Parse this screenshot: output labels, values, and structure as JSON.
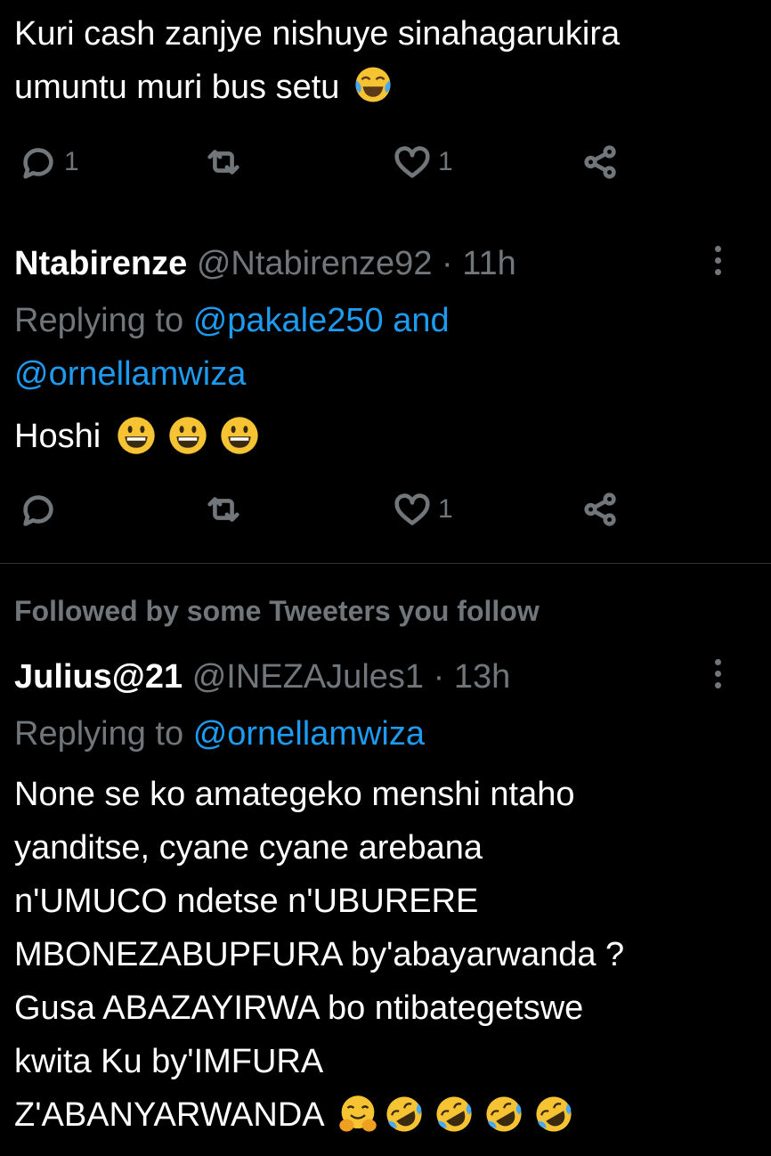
{
  "tweet1": {
    "text_line1": "Kuri cash zanjye nishuye sinahagarukira",
    "text_line2": "umuntu muri bus setu",
    "emoji": "face-with-tears-of-joy",
    "actions": {
      "reply_count": "1",
      "retweet_count": "",
      "like_count": "1"
    }
  },
  "tweet2": {
    "name": "Ntabirenze",
    "handle": "@Ntabirenze92",
    "separator": "·",
    "time": "11h",
    "replying_prefix": "Replying to",
    "replying_user1": "@pakale250",
    "replying_and": "and",
    "replying_user2": "@ornellamwiza",
    "text": "Hoshi",
    "emojis": [
      "grinning-face",
      "grinning-face",
      "grinning-face"
    ],
    "actions": {
      "reply_count": "",
      "retweet_count": "",
      "like_count": "1"
    }
  },
  "tweet3": {
    "context": "Followed by some Tweeters you follow",
    "name": "Julius@21",
    "handle": "@INEZAJules1",
    "separator": "·",
    "time": "13h",
    "replying_prefix": "Replying to",
    "replying_user1": "@ornellamwiza",
    "lines": [
      "None se ko amategeko menshi ntaho",
      "yanditse, cyane cyane arebana",
      "n'UMUCO ndetse n'UBURERE",
      "MBONEZABUPFURA by'abayarwanda ?",
      "Gusa ABAZAYIRWA bo ntibategetswe",
      "kwita Ku by'IMFURA",
      "Z'ABANYARWANDA"
    ],
    "emojis": [
      "hugging-face",
      "rolling-on-floor-laughing",
      "rolling-on-floor-laughing",
      "rolling-on-floor-laughing",
      "rolling-on-floor-laughing"
    ]
  },
  "colors": {
    "background": "#000000",
    "text": "#ffffff",
    "muted": "#71767b",
    "link": "#1d9bf0",
    "divider": "#2f3336"
  },
  "icons": [
    "reply-icon",
    "retweet-icon",
    "like-icon",
    "share-icon",
    "more-icon"
  ]
}
